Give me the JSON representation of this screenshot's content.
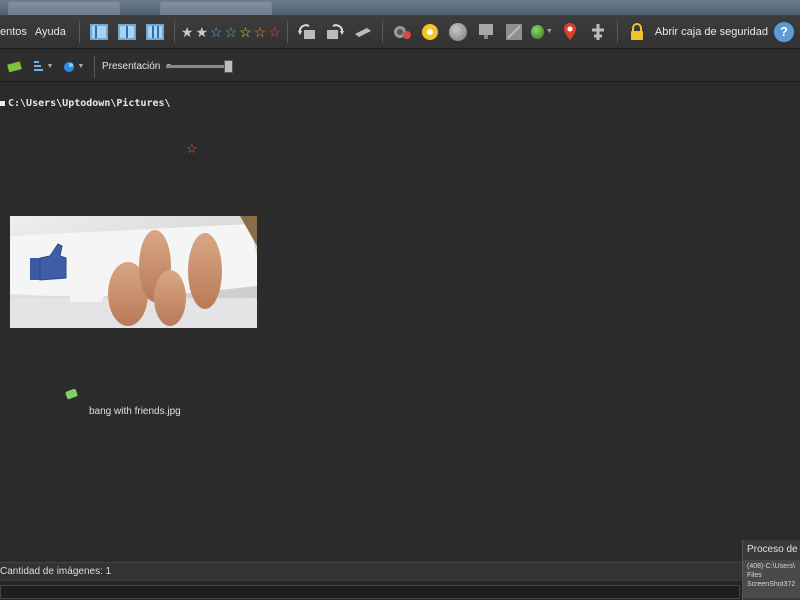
{
  "menu": {
    "items": [
      "entos",
      "Ayuda"
    ]
  },
  "toolbar": {
    "rating_stars": [
      "★",
      "★",
      "☆",
      "☆",
      "☆",
      "☆",
      "☆"
    ],
    "star_colors": [
      "#c9c9c9",
      "#c9c9c9",
      "#5fa8e6",
      "#59c25f",
      "#e0c43a",
      "#f08a2a",
      "#e84a4a"
    ],
    "lock_label": "Abrir caja de seguridad",
    "help_label": "?"
  },
  "toolbar2": {
    "slideshow_label": "Presentación"
  },
  "browser": {
    "path": "C:\\Users\\Uptodown\\Pictures\\",
    "thumbnails": [
      {
        "filename": "bang with friends.jpg",
        "rating_icon": "☆",
        "tag_color": "#7ed06a"
      }
    ]
  },
  "status": {
    "image_count": "Cantidad de imágenes: 1"
  },
  "process_panel": {
    "title": "Proceso de e",
    "lines": [
      "(408)-C:\\Users\\",
      "Files",
      "ScreenShot372"
    ]
  }
}
